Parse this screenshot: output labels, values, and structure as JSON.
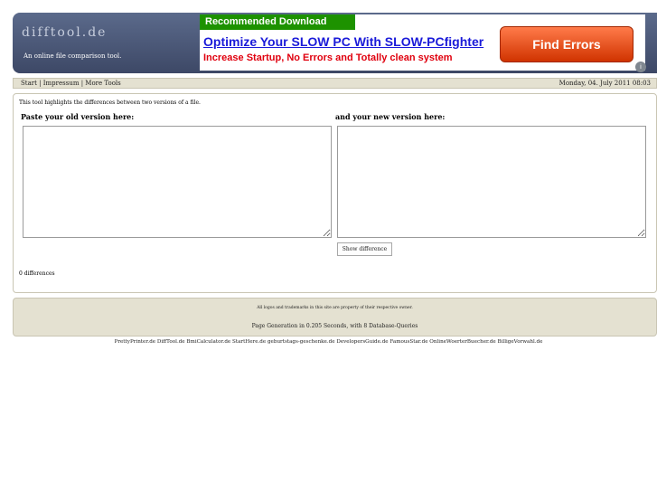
{
  "header": {
    "site_title": "difftool.de",
    "tagline": "An online file comparison tool."
  },
  "ad": {
    "label": "Recommended Download",
    "headline": "Optimize Your SLOW PC With SLOW-PCfighter",
    "subline": "Increase Startup, No Errors and Totally clean system",
    "cta": "Find Errors",
    "info_glyph": "i",
    "colors": {
      "label_bg": "#1d9200",
      "headline": "#1a1ad9",
      "subline": "#e0000e",
      "cta_bg": "#e04a10"
    }
  },
  "nav": {
    "links": [
      "Start",
      "Impressum",
      "More Tools"
    ],
    "separator": " | ",
    "date": "Monday, 04. July 2011 08:03"
  },
  "main": {
    "intro": "This tool highlights the differences between two versions of a file.",
    "old_label": "Paste your old version here:",
    "new_label": "and your new version here:",
    "old_value": "",
    "new_value": "",
    "button_label": "Show difference",
    "diff_count": "0 differences"
  },
  "footer": {
    "copyright": "All logos and trademarks in this site are property of their respective owner.",
    "generation": "Page Generation in 0.205 Seconds, with 8 Database-Queries"
  },
  "bottom_links": [
    "PrettyPrinter.de",
    "DiffTool.de",
    "BmiCalculator.de",
    "StartHere.de",
    "geburtstags-geschenke.de",
    "DevelopersGuide.de",
    "FamousStar.de",
    "OnlineWoerterBuecher.de",
    "BilligeVorwahl.de"
  ]
}
